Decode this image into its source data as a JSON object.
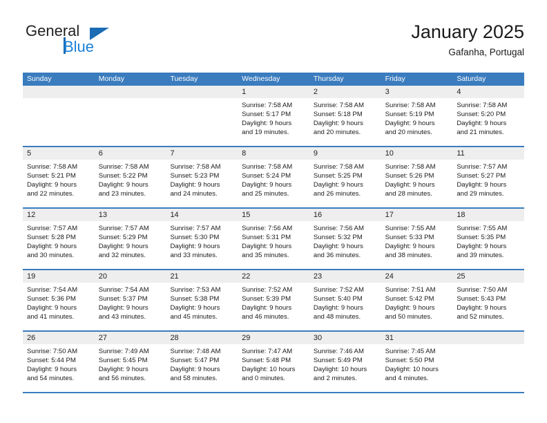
{
  "brand": {
    "name_top": "General",
    "name_bottom": "Blue",
    "accent_color": "#1b7fd4",
    "triangle_color": "#1b6cb5"
  },
  "header": {
    "title": "January 2025",
    "subtitle": "Gafanha, Portugal"
  },
  "theme": {
    "header_bg": "#3a7cbe",
    "header_text": "#ffffff",
    "day_band_bg": "#eeeeee",
    "cell_bg": "#ffffff",
    "text_color": "#1a1a1a"
  },
  "weekdays": [
    "Sunday",
    "Monday",
    "Tuesday",
    "Wednesday",
    "Thursday",
    "Friday",
    "Saturday"
  ],
  "weeks": [
    [
      {
        "day": "",
        "empty": true
      },
      {
        "day": "",
        "empty": true
      },
      {
        "day": "",
        "empty": true
      },
      {
        "day": "1",
        "sunrise": "Sunrise: 7:58 AM",
        "sunset": "Sunset: 5:17 PM",
        "daylight1": "Daylight: 9 hours",
        "daylight2": "and 19 minutes."
      },
      {
        "day": "2",
        "sunrise": "Sunrise: 7:58 AM",
        "sunset": "Sunset: 5:18 PM",
        "daylight1": "Daylight: 9 hours",
        "daylight2": "and 20 minutes."
      },
      {
        "day": "3",
        "sunrise": "Sunrise: 7:58 AM",
        "sunset": "Sunset: 5:19 PM",
        "daylight1": "Daylight: 9 hours",
        "daylight2": "and 20 minutes."
      },
      {
        "day": "4",
        "sunrise": "Sunrise: 7:58 AM",
        "sunset": "Sunset: 5:20 PM",
        "daylight1": "Daylight: 9 hours",
        "daylight2": "and 21 minutes."
      }
    ],
    [
      {
        "day": "5",
        "sunrise": "Sunrise: 7:58 AM",
        "sunset": "Sunset: 5:21 PM",
        "daylight1": "Daylight: 9 hours",
        "daylight2": "and 22 minutes."
      },
      {
        "day": "6",
        "sunrise": "Sunrise: 7:58 AM",
        "sunset": "Sunset: 5:22 PM",
        "daylight1": "Daylight: 9 hours",
        "daylight2": "and 23 minutes."
      },
      {
        "day": "7",
        "sunrise": "Sunrise: 7:58 AM",
        "sunset": "Sunset: 5:23 PM",
        "daylight1": "Daylight: 9 hours",
        "daylight2": "and 24 minutes."
      },
      {
        "day": "8",
        "sunrise": "Sunrise: 7:58 AM",
        "sunset": "Sunset: 5:24 PM",
        "daylight1": "Daylight: 9 hours",
        "daylight2": "and 25 minutes."
      },
      {
        "day": "9",
        "sunrise": "Sunrise: 7:58 AM",
        "sunset": "Sunset: 5:25 PM",
        "daylight1": "Daylight: 9 hours",
        "daylight2": "and 26 minutes."
      },
      {
        "day": "10",
        "sunrise": "Sunrise: 7:58 AM",
        "sunset": "Sunset: 5:26 PM",
        "daylight1": "Daylight: 9 hours",
        "daylight2": "and 28 minutes."
      },
      {
        "day": "11",
        "sunrise": "Sunrise: 7:57 AM",
        "sunset": "Sunset: 5:27 PM",
        "daylight1": "Daylight: 9 hours",
        "daylight2": "and 29 minutes."
      }
    ],
    [
      {
        "day": "12",
        "sunrise": "Sunrise: 7:57 AM",
        "sunset": "Sunset: 5:28 PM",
        "daylight1": "Daylight: 9 hours",
        "daylight2": "and 30 minutes."
      },
      {
        "day": "13",
        "sunrise": "Sunrise: 7:57 AM",
        "sunset": "Sunset: 5:29 PM",
        "daylight1": "Daylight: 9 hours",
        "daylight2": "and 32 minutes."
      },
      {
        "day": "14",
        "sunrise": "Sunrise: 7:57 AM",
        "sunset": "Sunset: 5:30 PM",
        "daylight1": "Daylight: 9 hours",
        "daylight2": "and 33 minutes."
      },
      {
        "day": "15",
        "sunrise": "Sunrise: 7:56 AM",
        "sunset": "Sunset: 5:31 PM",
        "daylight1": "Daylight: 9 hours",
        "daylight2": "and 35 minutes."
      },
      {
        "day": "16",
        "sunrise": "Sunrise: 7:56 AM",
        "sunset": "Sunset: 5:32 PM",
        "daylight1": "Daylight: 9 hours",
        "daylight2": "and 36 minutes."
      },
      {
        "day": "17",
        "sunrise": "Sunrise: 7:55 AM",
        "sunset": "Sunset: 5:33 PM",
        "daylight1": "Daylight: 9 hours",
        "daylight2": "and 38 minutes."
      },
      {
        "day": "18",
        "sunrise": "Sunrise: 7:55 AM",
        "sunset": "Sunset: 5:35 PM",
        "daylight1": "Daylight: 9 hours",
        "daylight2": "and 39 minutes."
      }
    ],
    [
      {
        "day": "19",
        "sunrise": "Sunrise: 7:54 AM",
        "sunset": "Sunset: 5:36 PM",
        "daylight1": "Daylight: 9 hours",
        "daylight2": "and 41 minutes."
      },
      {
        "day": "20",
        "sunrise": "Sunrise: 7:54 AM",
        "sunset": "Sunset: 5:37 PM",
        "daylight1": "Daylight: 9 hours",
        "daylight2": "and 43 minutes."
      },
      {
        "day": "21",
        "sunrise": "Sunrise: 7:53 AM",
        "sunset": "Sunset: 5:38 PM",
        "daylight1": "Daylight: 9 hours",
        "daylight2": "and 45 minutes."
      },
      {
        "day": "22",
        "sunrise": "Sunrise: 7:52 AM",
        "sunset": "Sunset: 5:39 PM",
        "daylight1": "Daylight: 9 hours",
        "daylight2": "and 46 minutes."
      },
      {
        "day": "23",
        "sunrise": "Sunrise: 7:52 AM",
        "sunset": "Sunset: 5:40 PM",
        "daylight1": "Daylight: 9 hours",
        "daylight2": "and 48 minutes."
      },
      {
        "day": "24",
        "sunrise": "Sunrise: 7:51 AM",
        "sunset": "Sunset: 5:42 PM",
        "daylight1": "Daylight: 9 hours",
        "daylight2": "and 50 minutes."
      },
      {
        "day": "25",
        "sunrise": "Sunrise: 7:50 AM",
        "sunset": "Sunset: 5:43 PM",
        "daylight1": "Daylight: 9 hours",
        "daylight2": "and 52 minutes."
      }
    ],
    [
      {
        "day": "26",
        "sunrise": "Sunrise: 7:50 AM",
        "sunset": "Sunset: 5:44 PM",
        "daylight1": "Daylight: 9 hours",
        "daylight2": "and 54 minutes."
      },
      {
        "day": "27",
        "sunrise": "Sunrise: 7:49 AM",
        "sunset": "Sunset: 5:45 PM",
        "daylight1": "Daylight: 9 hours",
        "daylight2": "and 56 minutes."
      },
      {
        "day": "28",
        "sunrise": "Sunrise: 7:48 AM",
        "sunset": "Sunset: 5:47 PM",
        "daylight1": "Daylight: 9 hours",
        "daylight2": "and 58 minutes."
      },
      {
        "day": "29",
        "sunrise": "Sunrise: 7:47 AM",
        "sunset": "Sunset: 5:48 PM",
        "daylight1": "Daylight: 10 hours",
        "daylight2": "and 0 minutes."
      },
      {
        "day": "30",
        "sunrise": "Sunrise: 7:46 AM",
        "sunset": "Sunset: 5:49 PM",
        "daylight1": "Daylight: 10 hours",
        "daylight2": "and 2 minutes."
      },
      {
        "day": "31",
        "sunrise": "Sunrise: 7:45 AM",
        "sunset": "Sunset: 5:50 PM",
        "daylight1": "Daylight: 10 hours",
        "daylight2": "and 4 minutes."
      },
      {
        "day": "",
        "empty": true
      }
    ]
  ]
}
